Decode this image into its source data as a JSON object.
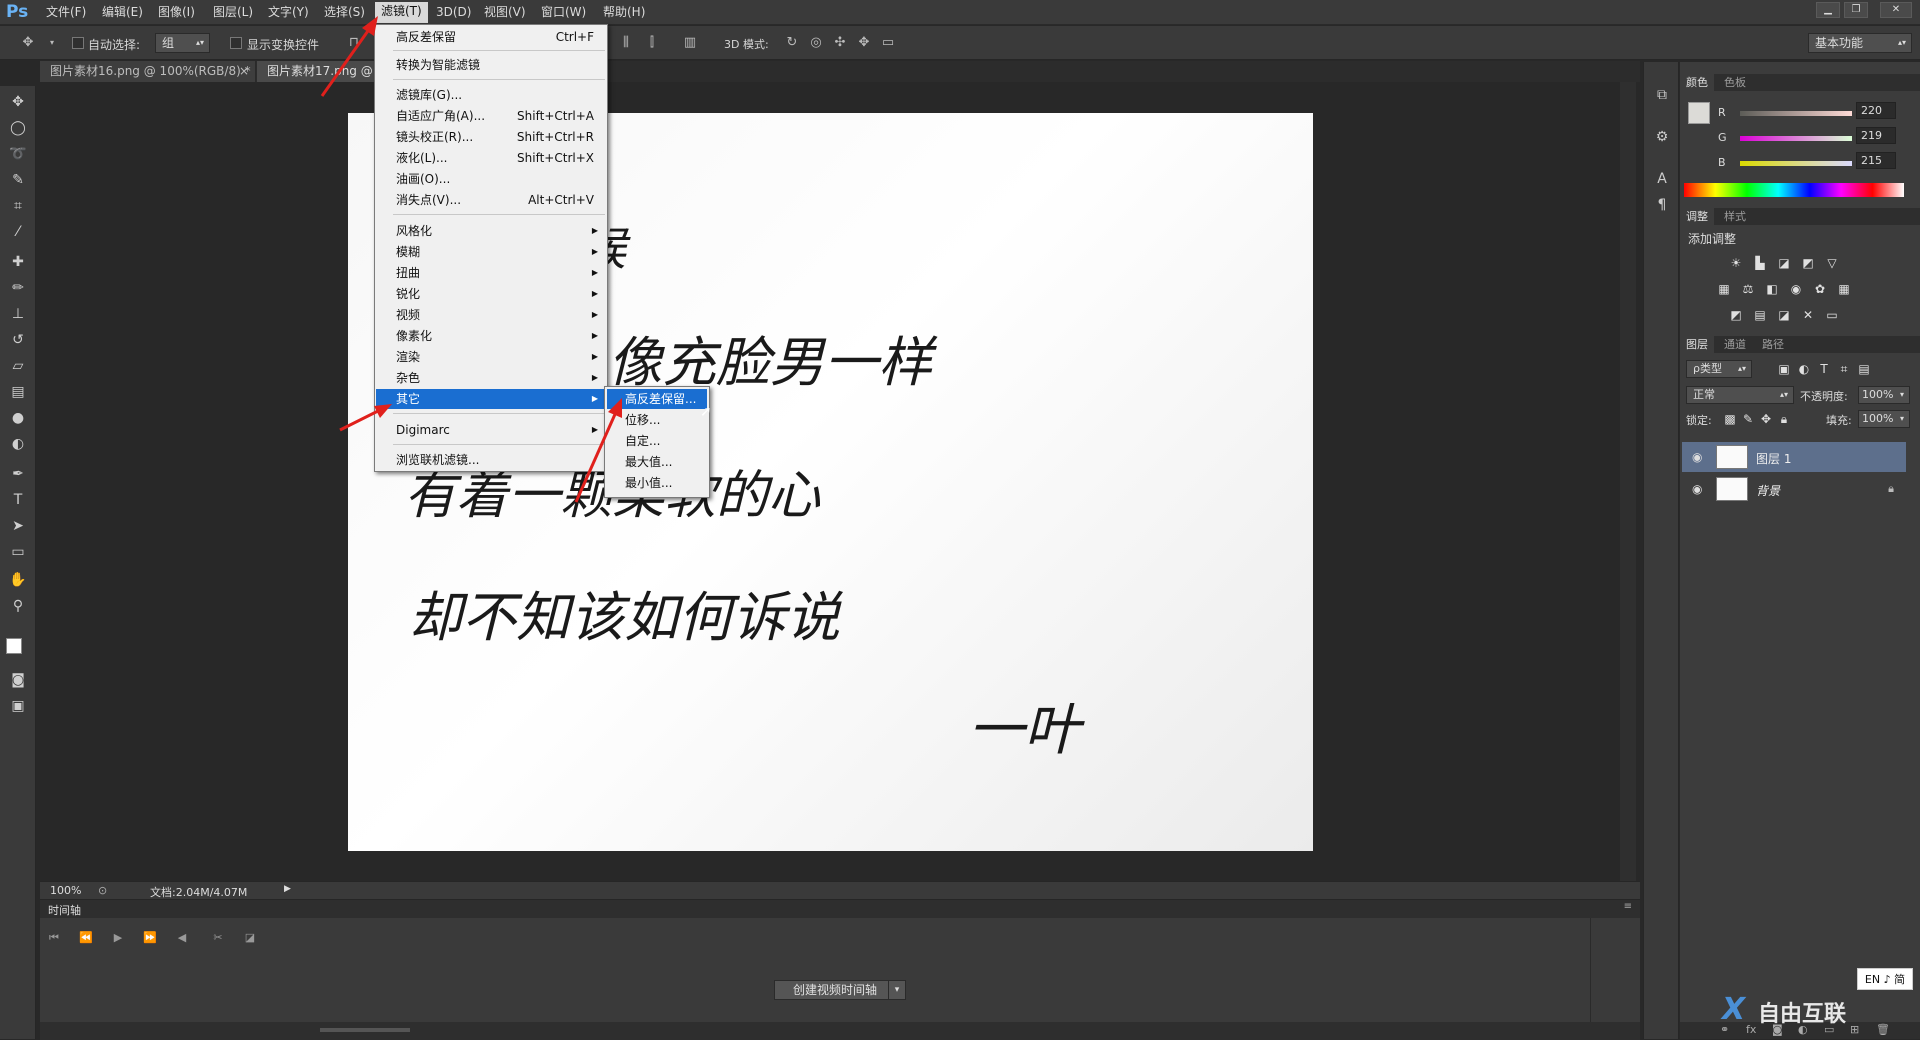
{
  "app": {
    "logo": "Ps"
  },
  "menubar": {
    "items": [
      "文件(F)",
      "编辑(E)",
      "图像(I)",
      "图层(L)",
      "文字(Y)",
      "选择(S)",
      "滤镜(T)",
      "3D(D)",
      "视图(V)",
      "窗口(W)",
      "帮助(H)"
    ],
    "active": "滤镜(T)"
  },
  "window_controls": {
    "minimize": "▁",
    "restore": "❐",
    "close": "✕"
  },
  "options_bar": {
    "auto_select_label": "自动选择:",
    "auto_select_value": "组",
    "show_transform_label": "显示变换控件",
    "mode_3d_label": "3D 模式:",
    "workspace_value": "基本功能"
  },
  "doc_tabs": [
    {
      "label": "图片素材16.png @ 100%(RGB/8) *",
      "close": "×"
    },
    {
      "label": "图片素材17.png @"
    }
  ],
  "canvas": {
    "handwriting": [
      "候",
      "像充脸男一样",
      "有着一颗柔软的心",
      "却不知该如何诉说",
      "一叶"
    ]
  },
  "status": {
    "zoom": "100%",
    "doc_info": "文档:2.04M/4.07M"
  },
  "timeline": {
    "title": "时间轴",
    "create_button": "创建视频时间轴"
  },
  "filter_menu": {
    "groups": [
      [
        {
          "label": "高反差保留",
          "shortcut": "Ctrl+F"
        }
      ],
      [
        {
          "label": "转换为智能滤镜"
        }
      ],
      [
        {
          "label": "滤镜库(G)..."
        },
        {
          "label": "自适应广角(A)...",
          "shortcut": "Shift+Ctrl+A"
        },
        {
          "label": "镜头校正(R)...",
          "shortcut": "Shift+Ctrl+R"
        },
        {
          "label": "液化(L)...",
          "shortcut": "Shift+Ctrl+X"
        },
        {
          "label": "油画(O)..."
        },
        {
          "label": "消失点(V)...",
          "shortcut": "Alt+Ctrl+V"
        }
      ],
      [
        {
          "label": "风格化",
          "submenu": true
        },
        {
          "label": "模糊",
          "submenu": true
        },
        {
          "label": "扭曲",
          "submenu": true
        },
        {
          "label": "锐化",
          "submenu": true
        },
        {
          "label": "视频",
          "submenu": true
        },
        {
          "label": "像素化",
          "submenu": true
        },
        {
          "label": "渲染",
          "submenu": true
        },
        {
          "label": "杂色",
          "submenu": true
        },
        {
          "label": "其它",
          "submenu": true,
          "highlighted": true
        }
      ],
      [
        {
          "label": "Digimarc",
          "submenu": true
        }
      ],
      [
        {
          "label": "浏览联机滤镜..."
        }
      ]
    ]
  },
  "other_submenu": {
    "items": [
      "高反差保留...",
      "位移...",
      "自定...",
      "最大值...",
      "最小值..."
    ],
    "highlighted": "高反差保留..."
  },
  "color_panel": {
    "tabs": [
      "颜色",
      "色板"
    ],
    "r": {
      "label": "R",
      "value": "220"
    },
    "g": {
      "label": "G",
      "value": "219"
    },
    "b": {
      "label": "B",
      "value": "215"
    }
  },
  "adjust_panel": {
    "tabs": [
      "调整",
      "样式"
    ],
    "title": "添加调整"
  },
  "layers_panel": {
    "tabs": [
      "图层",
      "通道",
      "路径"
    ],
    "kind_filter": "ρ类型",
    "blend_mode": "正常",
    "opacity_label": "不透明度:",
    "opacity_value": "100%",
    "lock_label": "锁定:",
    "fill_label": "填充:",
    "fill_value": "100%",
    "layers": [
      {
        "name": "图层 1",
        "selected": true
      },
      {
        "name": "背景",
        "locked": true
      }
    ]
  },
  "ime": {
    "label": "EN ♪ 简"
  },
  "watermark": {
    "label": "自由互联"
  },
  "colors": {
    "accent": "#1a6ed1",
    "menu_bg": "#f0f0f0",
    "ui_dark": "#3a3a3a",
    "arrow": "#e0201c"
  }
}
